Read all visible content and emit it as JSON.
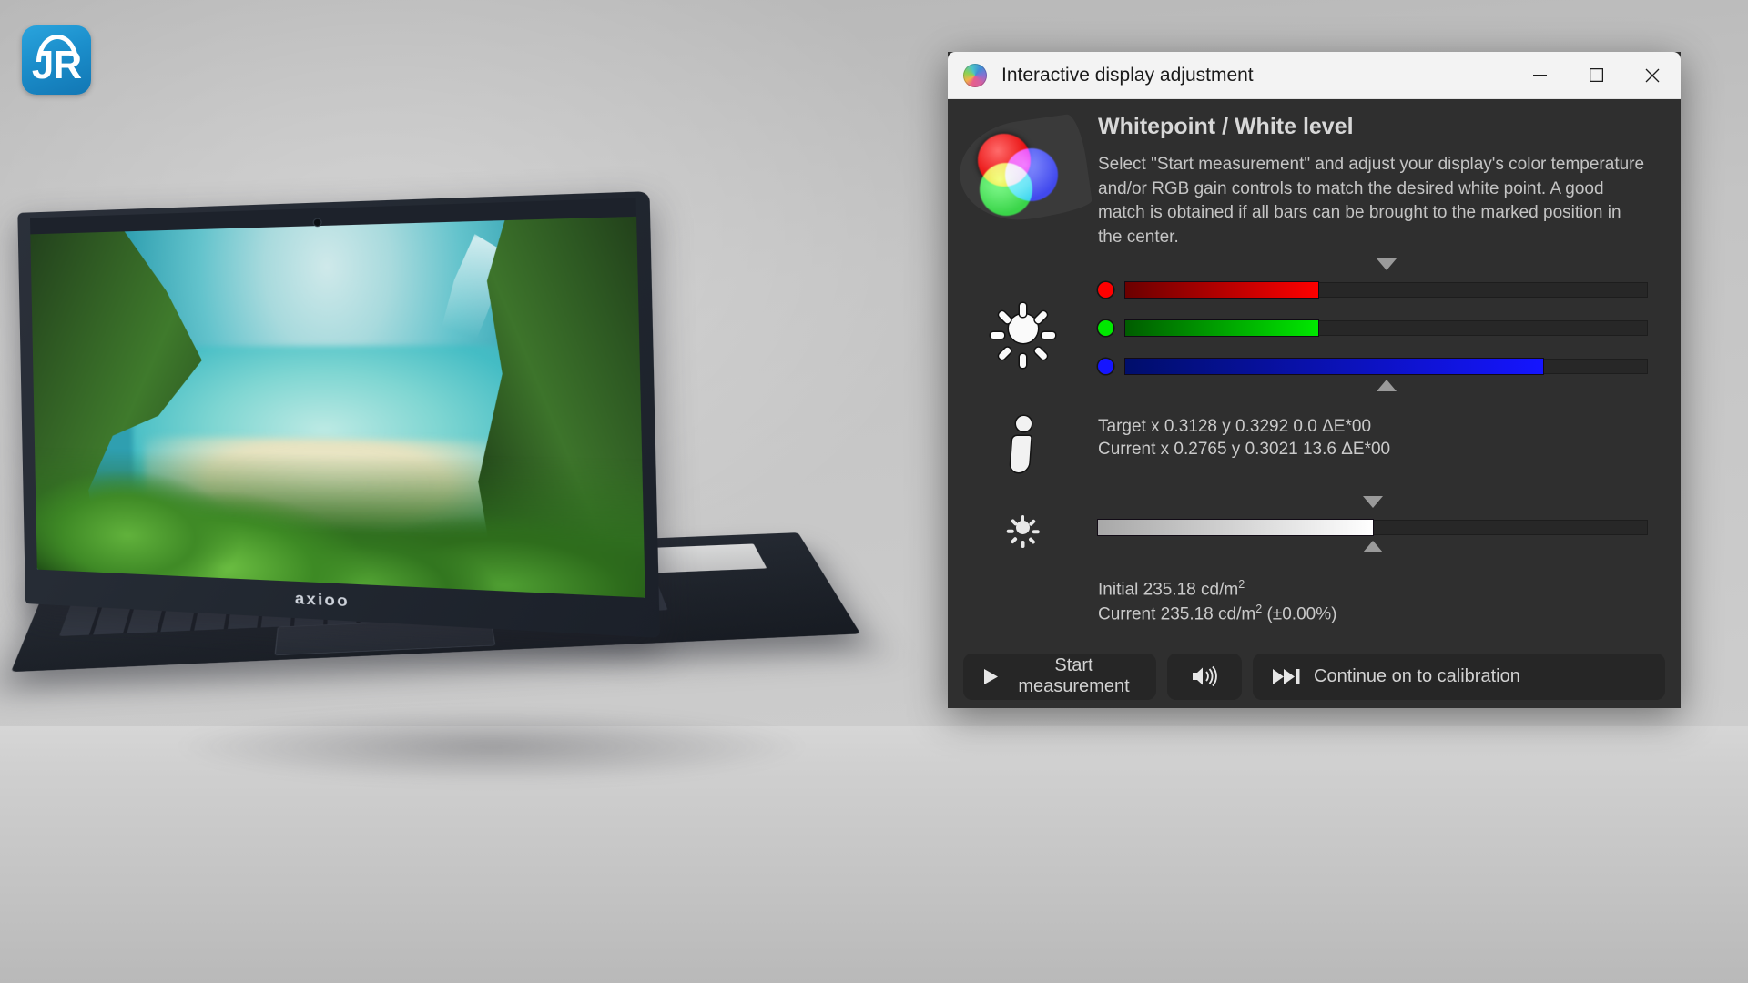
{
  "watermark": {
    "text": "JR",
    "name": "jr-logo"
  },
  "background": {
    "scene": "photo of a laptop on a desk against a grey wall",
    "laptop_brand": "axioo",
    "wallpaper": "aerial view of a tropical beach lagoon with green cliffs"
  },
  "window": {
    "title": "Interactive display adjustment",
    "app_icon": "displaycal-color-wheel-icon",
    "controls": {
      "minimize": "minimize-icon",
      "maximize": "maximize-icon",
      "close": "close-icon"
    }
  },
  "header": {
    "icon": "rgb-additive-circles-icon",
    "title": "Whitepoint / White level",
    "description": "Select \"Start measurement\" and adjust your display's color temperature and/or RGB gain controls to match the desired white point. A good match is obtained if all bars can be brought to the marked position in the center."
  },
  "rgb_section": {
    "icon": "sun-icon",
    "marker_top": "triangle-down-marker",
    "marker_bottom": "triangle-up-marker",
    "marker_position_percent": 50,
    "channels": [
      {
        "name": "red",
        "color": "#ff0000",
        "fill_percent": 37
      },
      {
        "name": "green",
        "color": "#00e800",
        "fill_percent": 37
      },
      {
        "name": "blue",
        "color": "#1515ff",
        "fill_percent": 80
      }
    ]
  },
  "readout": {
    "icon": "info-icon",
    "target_line": "Target x 0.3128 y 0.3292 0.0 ΔE*00",
    "current_line": "Current x 0.2765 y 0.3021 13.6 ΔE*00"
  },
  "brightness_section": {
    "icon": "brightness-small-sun-icon",
    "marker_top": "triangle-down-marker",
    "marker_bottom": "triangle-up-marker",
    "marker_position_percent": 50,
    "fill_percent": 50
  },
  "luminance": {
    "initial_label": "Initial 235.18 cd/m",
    "initial_sup": "2",
    "current_label": "Current 235.18 cd/m",
    "current_sup": "2",
    "current_suffix": " (±0.00%)"
  },
  "buttons": {
    "start": {
      "label": "Start measurement",
      "icon": "play-icon"
    },
    "sound": {
      "label": "",
      "icon": "speaker-icon"
    },
    "continue": {
      "label": "Continue on to calibration",
      "icon": "skip-forward-icon"
    }
  },
  "colors": {
    "window_bg": "#2f2f2f",
    "titlebar_bg": "#f3f3f3",
    "button_bg": "#262626",
    "text": "#cacaca",
    "heading": "#d8d8d8",
    "accent_red": "#ff0000",
    "accent_green": "#00e800",
    "accent_blue": "#1515ff"
  }
}
